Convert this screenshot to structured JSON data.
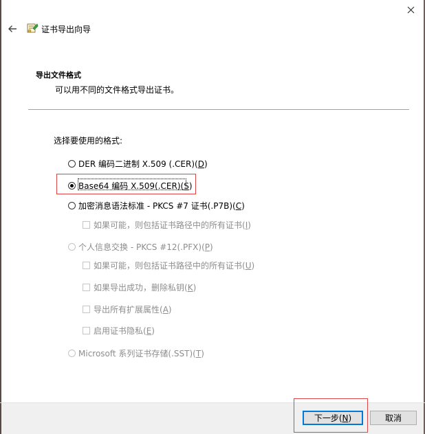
{
  "window": {
    "title": "证书导出向导"
  },
  "header": {
    "title": "导出文件格式",
    "description": "可以用不同的文件格式导出证书。"
  },
  "main": {
    "prompt": "选择要使用的格式:",
    "options": [
      {
        "text": "DER 编码二进制 X.509 (.CER)(",
        "key": "D",
        "close": ")",
        "checked": false,
        "enabled": true
      },
      {
        "text": "Base64 编码 X.509(.CER)(",
        "key": "S",
        "close": ")",
        "checked": true,
        "enabled": true
      },
      {
        "text": "加密消息语法标准 - PKCS #7 证书(.P7B)(",
        "key": "C",
        "close": ")",
        "checked": false,
        "enabled": true
      },
      {
        "text": "个人信息交换 - PKCS #12(.PFX)(",
        "key": "P",
        "close": ")",
        "checked": false,
        "enabled": false
      },
      {
        "text": "Microsoft 系列证书存储(.SST)(",
        "key": "T",
        "close": ")",
        "checked": false,
        "enabled": false
      }
    ],
    "checkboxes": [
      {
        "text": "如果可能，则包括证书路径中的所有证书(",
        "key": "I",
        "close": ")",
        "enabled": false
      },
      {
        "text": "如果可能，则包括证书路径中的所有证书(",
        "key": "U",
        "close": ")",
        "enabled": false
      },
      {
        "text": "如果导出成功，删除私钥(",
        "key": "K",
        "close": ")",
        "enabled": false
      },
      {
        "text": "导出所有扩展属性(",
        "key": "A",
        "close": ")",
        "enabled": false
      },
      {
        "text": "启用证书隐私(",
        "key": "E",
        "close": ")",
        "enabled": false
      }
    ]
  },
  "footer": {
    "next": {
      "text": "下一步(",
      "key": "N",
      "close": ")"
    },
    "cancel": "取消"
  },
  "colors": {
    "accent": "#0078d7",
    "highlight": "#e04545",
    "disabled_text": "#8d8d8d"
  },
  "icons": {
    "close": "close-icon",
    "back": "back-arrow-icon",
    "wizard": "certificate-wizard-icon"
  }
}
